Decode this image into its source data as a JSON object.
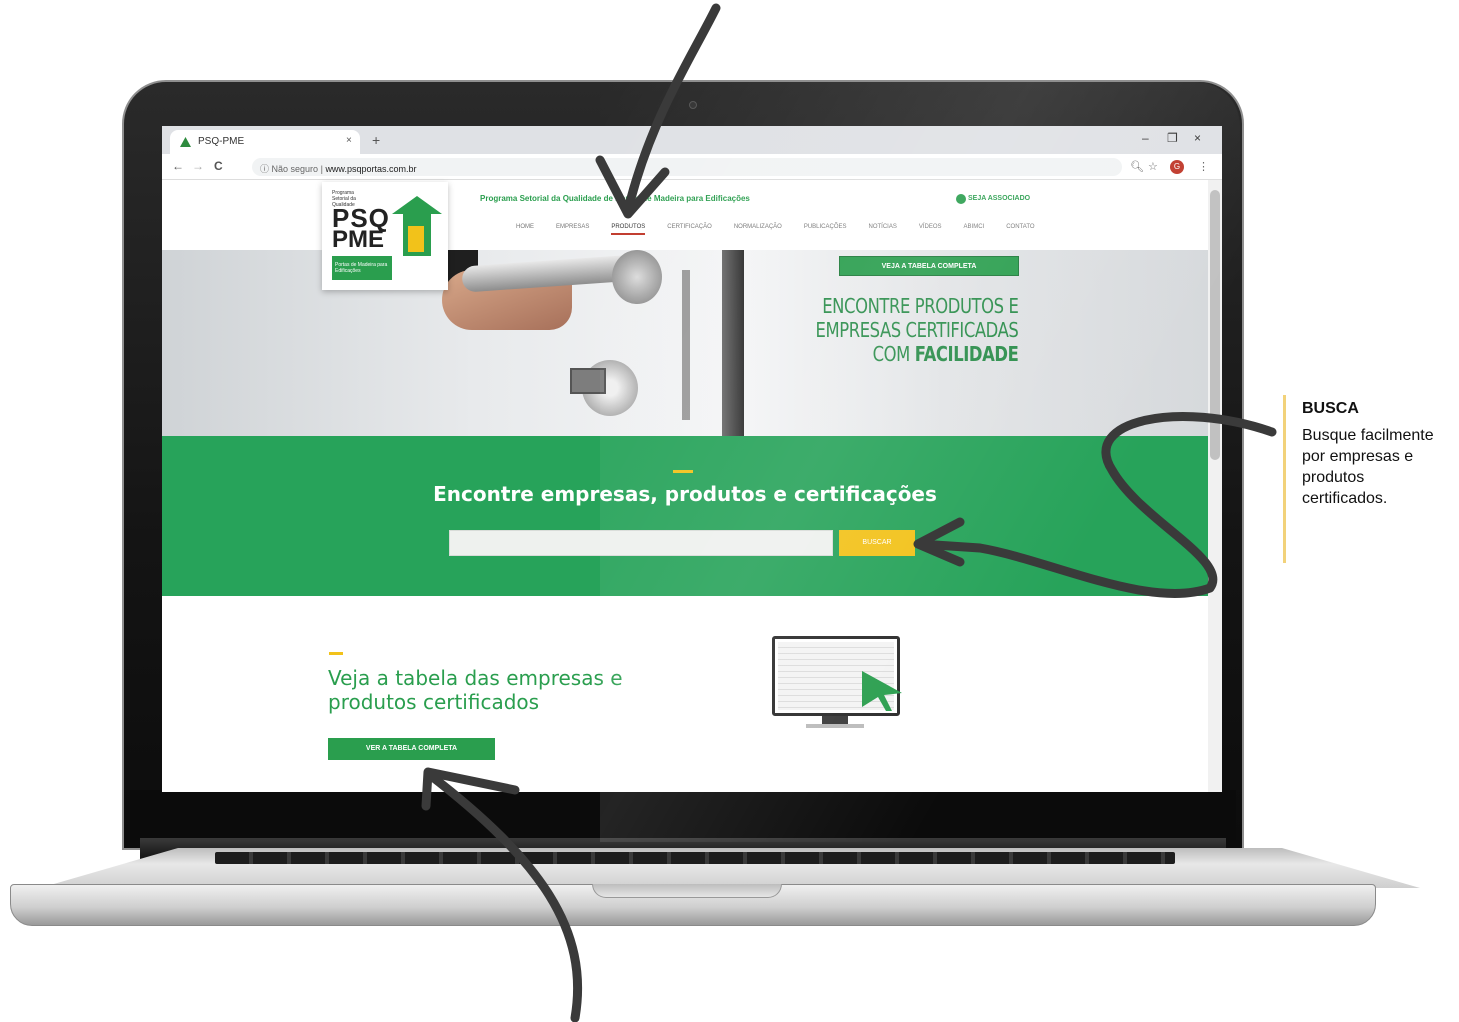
{
  "browser": {
    "tab_title": "PSQ-PME",
    "tab_close": "×",
    "new_tab": "+",
    "address_prefix": "Não seguro",
    "address_separator": "|",
    "address_host": "www.psqportas.com.br",
    "minimize": "–",
    "maximize": "❐",
    "close": "×",
    "back": "←",
    "forward": "→",
    "reload": "C",
    "info": "ⓘ",
    "zoom": "🔍︎",
    "star": "☆",
    "avatar": "G",
    "menu_dots": "⋮"
  },
  "site": {
    "logo": {
      "small_text": "Programa Setorial da Qualidade",
      "psq": "PSQ",
      "pme": "PME",
      "strip_text": "Portas de Madeira para Edificações"
    },
    "tagline": "Programa Setorial da Qualidade de Portas de Madeira para Edificações",
    "seja_label": "SEJA ASSOCIADO",
    "menu": [
      "HOME",
      "EMPRESAS",
      "PRODUTOS",
      "CERTIFICAÇÃO",
      "NORMALIZAÇÃO",
      "PUBLICAÇÕES",
      "NOTÍCIAS",
      "VÍDEOS",
      "ABIMCI",
      "CONTATO"
    ]
  },
  "hero": {
    "line1": "ENCONTRE PRODUTOS E",
    "line2": "EMPRESAS CERTIFICADAS",
    "line3_prefix": "COM ",
    "line3_strong": "FACILIDADE",
    "button": "VEJA A TABELA COMPLETA"
  },
  "search": {
    "title": "Encontre empresas, produtos e certificações",
    "placeholder": "",
    "button": "BUSCAR"
  },
  "table_section": {
    "title": "Veja a tabela das empresas e produtos certificados",
    "button": "VER A TABELA COMPLETA"
  },
  "annotation": {
    "title": "BUSCA",
    "description": "Busque facilmente por empresas e produtos certificados."
  },
  "colors": {
    "brand_green": "#27a35a",
    "accent_yellow": "#f2c21a",
    "active_underline": "#c0392b"
  }
}
